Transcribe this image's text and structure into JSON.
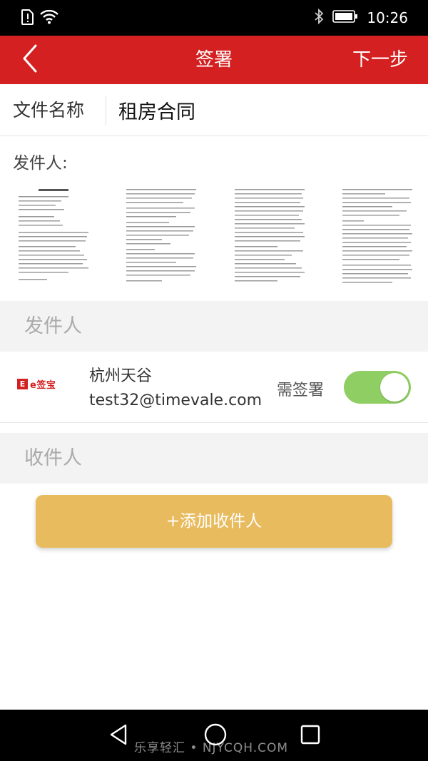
{
  "status_bar": {
    "time": "10:26",
    "icons": [
      "sim-alert-icon",
      "wifi-icon",
      "bluetooth-icon",
      "battery-icon"
    ]
  },
  "header": {
    "back_icon": "chevron-left-icon",
    "title": "签署",
    "next_label": "下一步",
    "color": "#d42020"
  },
  "file": {
    "label": "文件名称",
    "value": "租房合同"
  },
  "documents": {
    "label": "发件人:",
    "page_count": 4
  },
  "sender_section": {
    "title": "发件人",
    "sender": {
      "logo_text": "e签宝",
      "logo_mark": "E",
      "name": "杭州天谷",
      "email": "test32@timevale.com",
      "sign_label": "需签署",
      "sign_required": true
    }
  },
  "receiver_section": {
    "title": "收件人"
  },
  "add_receiver": {
    "label": "+添加收件人",
    "color": "#e9bb5f"
  },
  "nav_bar": {
    "icons": [
      "back-triangle-icon",
      "home-circle-icon",
      "recent-square-icon"
    ],
    "watermark": "乐享轻汇 • NJYCQH.COM"
  }
}
